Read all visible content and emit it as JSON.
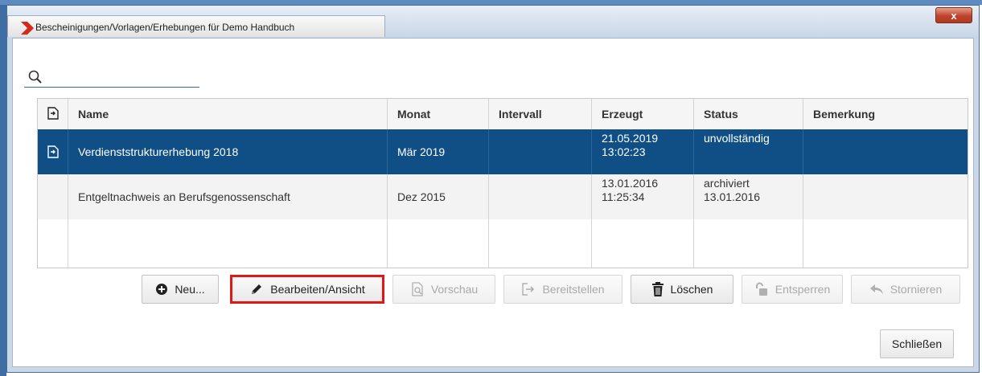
{
  "window": {
    "title": "Bescheinigungen/Vorlagen/Erhebungen für Demo Handbuch",
    "close_label": "x"
  },
  "search": {
    "value": "",
    "placeholder": ""
  },
  "table": {
    "columns": [
      "Name",
      "Monat",
      "Intervall",
      "Erzeugt",
      "Status",
      "Bemerkung"
    ],
    "rows": [
      {
        "name": "Verdienststrukturerhebung 2018",
        "monat": "Mär 2019",
        "intervall": "",
        "erzeugt_date": "21.05.2019",
        "erzeugt_time": "13:02:23",
        "status_line1": "unvollständig",
        "status_line2": "",
        "bemerkung": "",
        "selected": true,
        "icon": "document-export-icon"
      },
      {
        "name": "Entgeltnachweis an Berufsgenossenschaft",
        "monat": "Dez 2015",
        "intervall": "",
        "erzeugt_date": "13.01.2016",
        "erzeugt_time": "11:25:34",
        "status_line1": "archiviert",
        "status_line2": "13.01.2016",
        "bemerkung": "",
        "selected": false,
        "icon": ""
      }
    ]
  },
  "buttons": {
    "neu": "Neu...",
    "bearbeiten": "Bearbeiten/Ansicht",
    "vorschau": "Vorschau",
    "bereitstellen": "Bereitstellen",
    "loeschen": "Löschen",
    "entsperren": "Entsperren",
    "stornieren": "Stornieren",
    "schliessen": "Schließen"
  },
  "colors": {
    "selection": "#0f4f86",
    "highlight_border": "#e01818",
    "accent": "#2f6ca5"
  }
}
